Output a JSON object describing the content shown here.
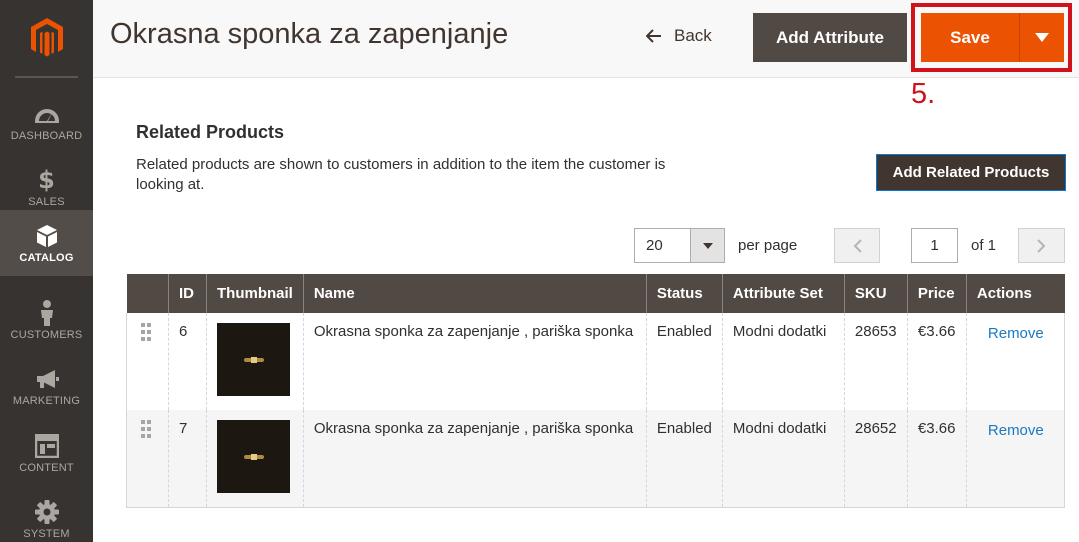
{
  "sidebar": {
    "logo": "magento-logo",
    "items": [
      {
        "label": "DASHBOARD",
        "icon": "dashboard-icon",
        "active": false
      },
      {
        "label": "SALES",
        "icon": "dollar-icon",
        "active": false
      },
      {
        "label": "CATALOG",
        "icon": "cube-icon",
        "active": true
      },
      {
        "label": "CUSTOMERS",
        "icon": "person-icon",
        "active": false
      },
      {
        "label": "MARKETING",
        "icon": "megaphone-icon",
        "active": false
      },
      {
        "label": "CONTENT",
        "icon": "layout-icon",
        "active": false
      },
      {
        "label": "SYSTEM",
        "icon": "gear-icon",
        "active": false
      }
    ]
  },
  "header": {
    "title": "Okrasna sponka za zapenjanje",
    "back_label": "Back",
    "add_attribute_label": "Add Attribute",
    "save_label": "Save",
    "annotation": "5."
  },
  "related": {
    "title": "Related Products",
    "description": "Related products are shown to customers in addition to the item the customer is looking at.",
    "add_button_label": "Add Related Products"
  },
  "pager": {
    "per_page_value": "20",
    "per_page_label": "per page",
    "current_page": "1",
    "of_label": "of 1"
  },
  "grid": {
    "columns": [
      "",
      "ID",
      "Thumbnail",
      "Name",
      "Status",
      "Attribute Set",
      "SKU",
      "Price",
      "Actions"
    ],
    "rows": [
      {
        "id": "6",
        "name": "Okrasna sponka za zapenjanje , pariška sponka",
        "status": "Enabled",
        "attribute_set": "Modni dodatki",
        "sku": "28653",
        "price": "€3.66",
        "action": "Remove"
      },
      {
        "id": "7",
        "name": "Okrasna sponka za zapenjanje , pariška sponka",
        "status": "Enabled",
        "attribute_set": "Modni dodatki",
        "sku": "28652",
        "price": "€3.66",
        "action": "Remove"
      }
    ]
  },
  "colors": {
    "sidebar_bg": "#373330",
    "accent_orange": "#eb5202",
    "annotation_red": "#d0121b",
    "dark_button": "#514943",
    "link_blue": "#1979c3"
  }
}
